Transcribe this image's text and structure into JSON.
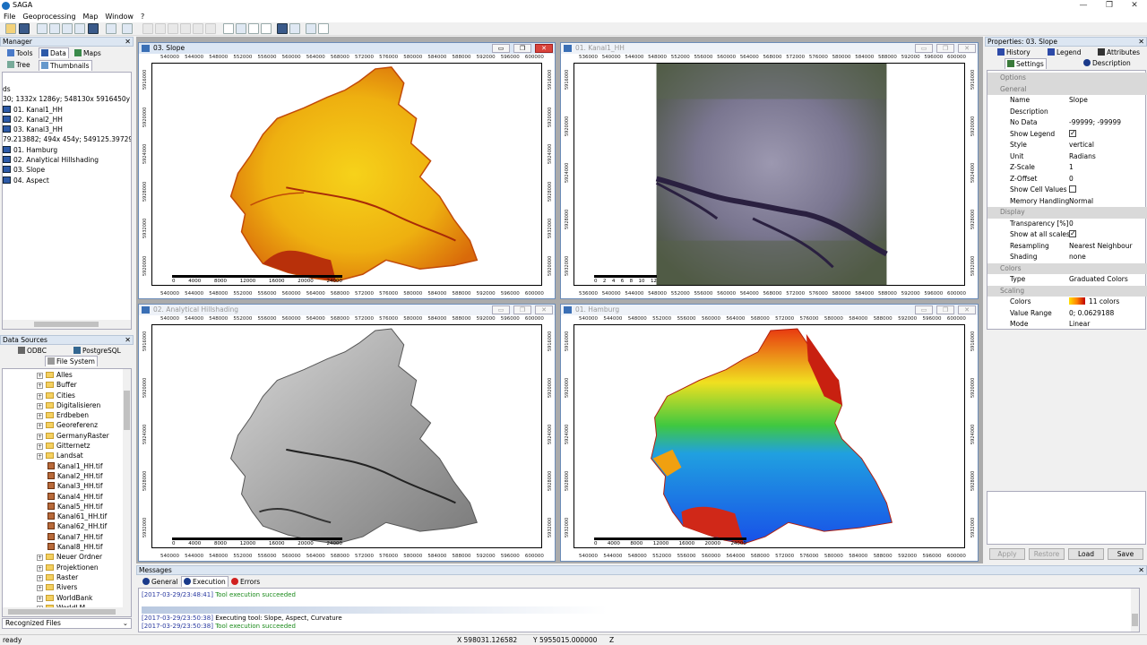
{
  "window": {
    "title": "SAGA",
    "controls": [
      "—",
      "❐",
      "✕"
    ]
  },
  "menu": [
    "File",
    "Geoprocessing",
    "Map",
    "Window",
    "?"
  ],
  "manager": {
    "title": "Manager",
    "tabs": [
      "Tools",
      "Data",
      "Maps"
    ],
    "subtabs": [
      "Tree",
      "Thumbnails"
    ],
    "tree": [
      "ds",
      "30; 1332x 1286y; 548130x 5916450y",
      "01. Kanal1_HH",
      "02. Kanal2_HH",
      "03. Kanal3_HH",
      "79.213882; 494x 454y; 549125.397290x 591",
      "01. Hamburg",
      "02. Analytical Hillshading",
      "03. Slope",
      "04. Aspect"
    ]
  },
  "datasources": {
    "title": "Data Sources",
    "tabs": [
      "ODBC",
      "PostgreSQL",
      "File System"
    ],
    "folders_top": [
      "Alles",
      "Buffer",
      "Cities",
      "Digitalisieren",
      "Erdbeben",
      "Georeferenz",
      "GermanyRaster",
      "Gitternetz",
      "Landsat"
    ],
    "files": [
      "Kanal1_HH.tif",
      "Kanal2_HH.tif",
      "Kanal3_HH.tif",
      "Kanal4_HH.tif",
      "Kanal5_HH.tif",
      "Kanal61_HH.tif",
      "Kanal62_HH.tif",
      "Kanal7_HH.tif",
      "Kanal8_HH.tif"
    ],
    "folders_bottom": [
      "Neuer Ordner",
      "Projektionen",
      "Raster",
      "Rivers",
      "WorldBank",
      "WorldLM"
    ],
    "dropdown": "Recognized Files"
  },
  "maps": {
    "slope": {
      "title": "03. Slope",
      "axis": [
        "540000",
        "544000",
        "548000",
        "552000",
        "556000",
        "560000",
        "564000",
        "568000",
        "572000",
        "576000",
        "580000",
        "584000",
        "588000",
        "592000",
        "596000",
        "600000"
      ],
      "yaxis": [
        "5920000",
        "5932000",
        "5928000",
        "5924000",
        "5920000",
        "5916000"
      ],
      "scale": [
        "0",
        "4000",
        "8000",
        "12000",
        "16000",
        "20000",
        "24000"
      ]
    },
    "kanal": {
      "title": "01. Kanal1_HH",
      "axis": [
        "536000",
        "540000",
        "544000",
        "548000",
        "552000",
        "556000",
        "560000",
        "564000",
        "568000",
        "572000",
        "576000",
        "580000",
        "584000",
        "588000",
        "592000",
        "596000",
        "600000"
      ],
      "yaxis": [
        "5932000",
        "5928000",
        "5924000",
        "5920000",
        "5916000"
      ],
      "scale": [
        "0",
        "2",
        "4",
        "6",
        "8",
        "10",
        "12"
      ]
    },
    "hill": {
      "title": "02. Analytical Hillshading",
      "axis": [
        "540000",
        "544000",
        "548000",
        "552000",
        "556000",
        "560000",
        "564000",
        "568000",
        "572000",
        "576000",
        "580000",
        "584000",
        "588000",
        "592000",
        "596000",
        "600000"
      ],
      "yaxis": [
        "5932000",
        "5928000",
        "5924000",
        "5920000",
        "5916000"
      ],
      "scale": [
        "0",
        "4000",
        "8000",
        "12000",
        "16000",
        "20000",
        "24000"
      ]
    },
    "hamburg": {
      "title": "01. Hamburg",
      "axis": [
        "540000",
        "544000",
        "548000",
        "552000",
        "556000",
        "560000",
        "564000",
        "568000",
        "572000",
        "576000",
        "580000",
        "584000",
        "588000",
        "592000",
        "596000",
        "600000"
      ],
      "yaxis": [
        "5932000",
        "5928000",
        "5924000",
        "5920000",
        "5916000"
      ],
      "scale": [
        "0",
        "4000",
        "8000",
        "12000",
        "16000",
        "20000",
        "24000"
      ]
    }
  },
  "properties": {
    "title": "Properties: 03. Slope",
    "tabs": [
      "History",
      "Legend",
      "Attributes",
      "Settings",
      "Description"
    ],
    "rows": [
      {
        "type": "cat",
        "k": "Options",
        "v": ""
      },
      {
        "type": "cat",
        "k": "General",
        "v": ""
      },
      {
        "type": "row",
        "k": "Name",
        "v": "Slope"
      },
      {
        "type": "row",
        "k": "Description",
        "v": ""
      },
      {
        "type": "row",
        "k": "No Data",
        "v": "-99999; -99999"
      },
      {
        "type": "row",
        "k": "Show Legend",
        "v": "check"
      },
      {
        "type": "row",
        "k": "Style",
        "v": "vertical"
      },
      {
        "type": "row",
        "k": "Unit",
        "v": "Radians"
      },
      {
        "type": "row",
        "k": "Z-Scale",
        "v": "1"
      },
      {
        "type": "row",
        "k": "Z-Offset",
        "v": "0"
      },
      {
        "type": "row",
        "k": "Show Cell Values",
        "v": "uncheck"
      },
      {
        "type": "row",
        "k": "Memory Handling",
        "v": "Normal"
      },
      {
        "type": "cat",
        "k": "Display",
        "v": ""
      },
      {
        "type": "row",
        "k": "Transparency [%]",
        "v": "0"
      },
      {
        "type": "row",
        "k": "Show at all scales",
        "v": "check"
      },
      {
        "type": "row",
        "k": "Resampling",
        "v": "Nearest Neighbour"
      },
      {
        "type": "row",
        "k": "Shading",
        "v": "none"
      },
      {
        "type": "cat",
        "k": "Colors",
        "v": ""
      },
      {
        "type": "row",
        "k": "Type",
        "v": "Graduated Colors"
      },
      {
        "type": "cat",
        "k": "Scaling",
        "v": ""
      },
      {
        "type": "row",
        "k": "Colors",
        "v": "11 colors"
      },
      {
        "type": "row",
        "k": "Value Range",
        "v": "0; 0.0629188"
      },
      {
        "type": "row",
        "k": "Mode",
        "v": "Linear"
      }
    ],
    "buttons": [
      "Apply",
      "Restore",
      "Load",
      "Save"
    ]
  },
  "messages": {
    "title": "Messages",
    "tabs": [
      "General",
      "Execution",
      "Errors"
    ],
    "lines": [
      {
        "ts": "[2017-03-29/23:48:41]",
        "text": "Tool execution succeeded",
        "ok": true
      },
      {
        "ts": "[2017-03-29/23:50:38]",
        "text": "Executing tool: Slope, Aspect, Curvature",
        "ok": false
      },
      {
        "ts": "[2017-03-29/23:50:38]",
        "text": "Tool execution succeeded",
        "ok": true
      }
    ]
  },
  "status": {
    "left": "ready",
    "x": "X 598031.126582",
    "y": "Y 5955015.000000",
    "z": "Z"
  }
}
